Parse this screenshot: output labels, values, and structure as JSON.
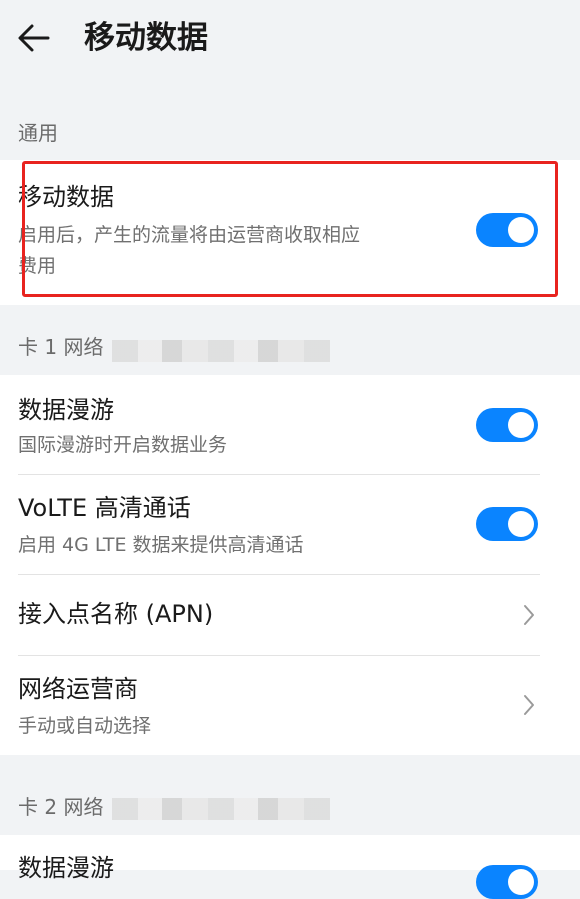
{
  "header": {
    "title": "移动数据",
    "back_icon": "arrow-left-icon"
  },
  "general": {
    "section_label": "通用",
    "mobile_data": {
      "title": "移动数据",
      "subtitle_line1": "启用后，产生的流量将由运营商收取相应",
      "subtitle_line2": "费用",
      "enabled": true
    }
  },
  "sim1": {
    "section_label": "卡 1 网络",
    "items": [
      {
        "title": "数据漫游",
        "subtitle": "国际漫游时开启数据业务",
        "enabled": true
      },
      {
        "title": "VoLTE 高清通话",
        "subtitle": "启用 4G LTE 数据来提供高清通话",
        "enabled": true
      },
      {
        "title": "接入点名称 (APN)"
      },
      {
        "title": "网络运营商",
        "subtitle": "手动或自动选择"
      }
    ]
  },
  "sim2": {
    "section_label": "卡 2 网络",
    "items": [
      {
        "title": "数据漫游"
      }
    ]
  },
  "colors": {
    "accent": "#0a84ff",
    "highlight": "#e8231f",
    "background": "#f1f3f5"
  }
}
